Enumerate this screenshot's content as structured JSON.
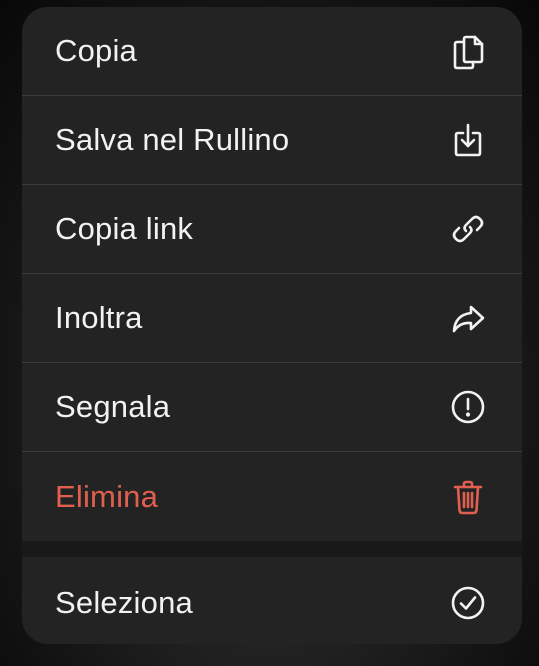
{
  "menu": {
    "items": [
      {
        "label": "Copia",
        "icon": "copy-icon"
      },
      {
        "label": "Salva nel Rullino",
        "icon": "save-download-icon"
      },
      {
        "label": "Copia link",
        "icon": "link-icon"
      },
      {
        "label": "Inoltra",
        "icon": "forward-arrow-icon"
      },
      {
        "label": "Segnala",
        "icon": "exclamation-circle-icon"
      },
      {
        "label": "Elimina",
        "icon": "trash-icon",
        "color": "#e0604f"
      }
    ],
    "secondary": [
      {
        "label": "Seleziona",
        "icon": "checkmark-circle-icon"
      }
    ]
  },
  "colors": {
    "text": "#f2f2f2",
    "destructive": "#e0604f",
    "menu_background": "#232323"
  }
}
